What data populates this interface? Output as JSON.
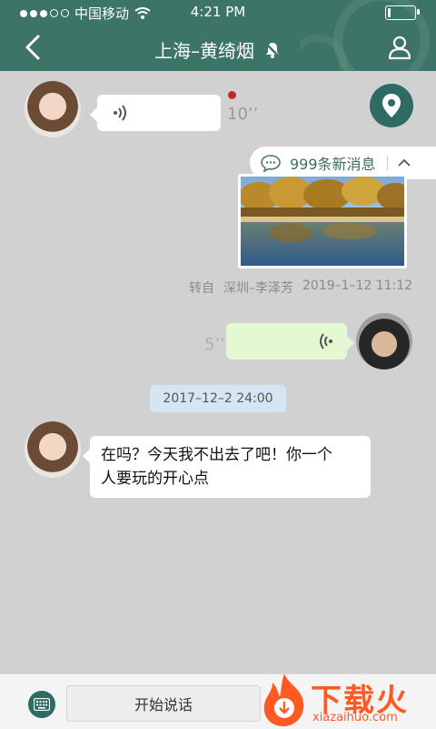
{
  "status_bar": {
    "carrier": "中国移动",
    "time": "4:21 PM",
    "battery_level": 0.12
  },
  "header": {
    "title": "上海–黄绮烟",
    "background": "#3d7468"
  },
  "messages": {
    "voice_incoming": {
      "duration": "10’’"
    },
    "new_messages": {
      "label": "999条新消息"
    },
    "forwarded": {
      "prefix": "转自",
      "source": "深圳–李泽芳",
      "timestamp": "2019–1–12 11:12"
    },
    "voice_outgoing": {
      "duration": "5’’"
    },
    "date_separator": "2017–12–2  24:00",
    "text_incoming": {
      "line1": "在吗？今天我不出去了吧！你一个",
      "line2": "人要玩的开心点"
    }
  },
  "input_bar": {
    "speak_label": "开始说话"
  },
  "watermark": {
    "title": "下载火",
    "subtitle": "xiazaihuo.com"
  },
  "icons": {
    "back": "back-arrow-icon",
    "mute": "bell-muted-icon",
    "profile": "person-icon",
    "location": "map-pin-icon",
    "chat": "chat-bubble-icon",
    "keyboard": "keyboard-icon",
    "voice": "voice-wave-icon"
  },
  "colors": {
    "accent": "#3d7468",
    "unread": "#c0282c",
    "outgoing_bubble": "#e4f8d4",
    "date_chip": "#d5e5f3"
  }
}
